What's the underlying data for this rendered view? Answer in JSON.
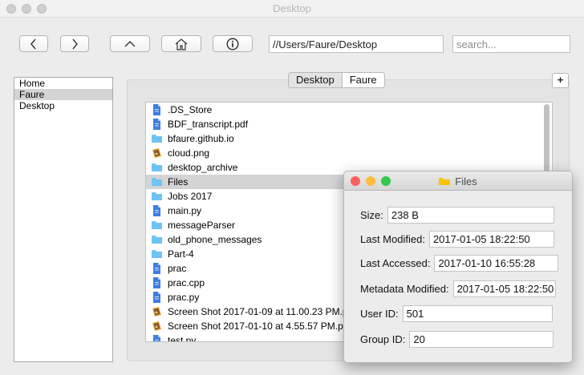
{
  "window": {
    "title": "Desktop"
  },
  "toolbar": {
    "back_icon": "chevron-left-icon",
    "forward_icon": "chevron-right-icon",
    "up_icon": "chevron-up-icon",
    "home_icon": "home-icon",
    "info_icon": "info-icon",
    "path_value": "//Users/Faure/Desktop",
    "search_placeholder": "search..."
  },
  "sidebar": {
    "items": [
      {
        "label": "Home",
        "selected": false
      },
      {
        "label": "Faure",
        "selected": true
      },
      {
        "label": "Desktop",
        "selected": false
      }
    ]
  },
  "tabs": [
    {
      "label": "Desktop",
      "active": true
    },
    {
      "label": "Faure",
      "active": false
    }
  ],
  "add_tab_label": "+",
  "files": [
    {
      "name": ".DS_Store",
      "icon": "document-icon",
      "selected": false
    },
    {
      "name": "BDF_transcript.pdf",
      "icon": "document-icon",
      "selected": false
    },
    {
      "name": "bfaure.github.io",
      "icon": "folder-icon",
      "selected": false
    },
    {
      "name": "cloud.png",
      "icon": "image-icon",
      "selected": false
    },
    {
      "name": "desktop_archive",
      "icon": "folder-icon",
      "selected": false
    },
    {
      "name": "Files",
      "icon": "folder-icon",
      "selected": true
    },
    {
      "name": "Jobs 2017",
      "icon": "folder-icon",
      "selected": false
    },
    {
      "name": "main.py",
      "icon": "document-icon",
      "selected": false
    },
    {
      "name": "messageParser",
      "icon": "folder-icon",
      "selected": false
    },
    {
      "name": "old_phone_messages",
      "icon": "folder-icon",
      "selected": false
    },
    {
      "name": "Part-4",
      "icon": "folder-icon",
      "selected": false
    },
    {
      "name": "prac",
      "icon": "document-icon",
      "selected": false
    },
    {
      "name": "prac.cpp",
      "icon": "document-icon",
      "selected": false
    },
    {
      "name": "prac.py",
      "icon": "document-icon",
      "selected": false
    },
    {
      "name": "Screen Shot 2017-01-09 at 11.00.23 PM.png",
      "icon": "image-icon",
      "selected": false
    },
    {
      "name": "Screen Shot 2017-01-10 at 4.55.57 PM.png",
      "icon": "image-icon",
      "selected": false
    },
    {
      "name": "test.py",
      "icon": "document-icon",
      "selected": false
    }
  ],
  "popup": {
    "title": "Files",
    "title_icon": "folder-icon",
    "size_label": "Size:",
    "size_value": "238 B",
    "modified_label": "Last Modified:",
    "modified_value": "2017-01-05 18:22:50",
    "accessed_label": "Last Accessed:",
    "accessed_value": "2017-01-10 16:55:28",
    "metadata_label": "Metadata Modified:",
    "metadata_value": "2017-01-05 18:22:50",
    "user_label": "User ID:",
    "user_value": "501",
    "group_label": "Group ID:",
    "group_value": "20"
  },
  "colors": {
    "close": "#fc605c",
    "minimize": "#fdbc40",
    "zoom": "#34c84a",
    "folder": "#6dc4f2",
    "document": "#3d7ee3",
    "selection": "#d4d4d4"
  }
}
